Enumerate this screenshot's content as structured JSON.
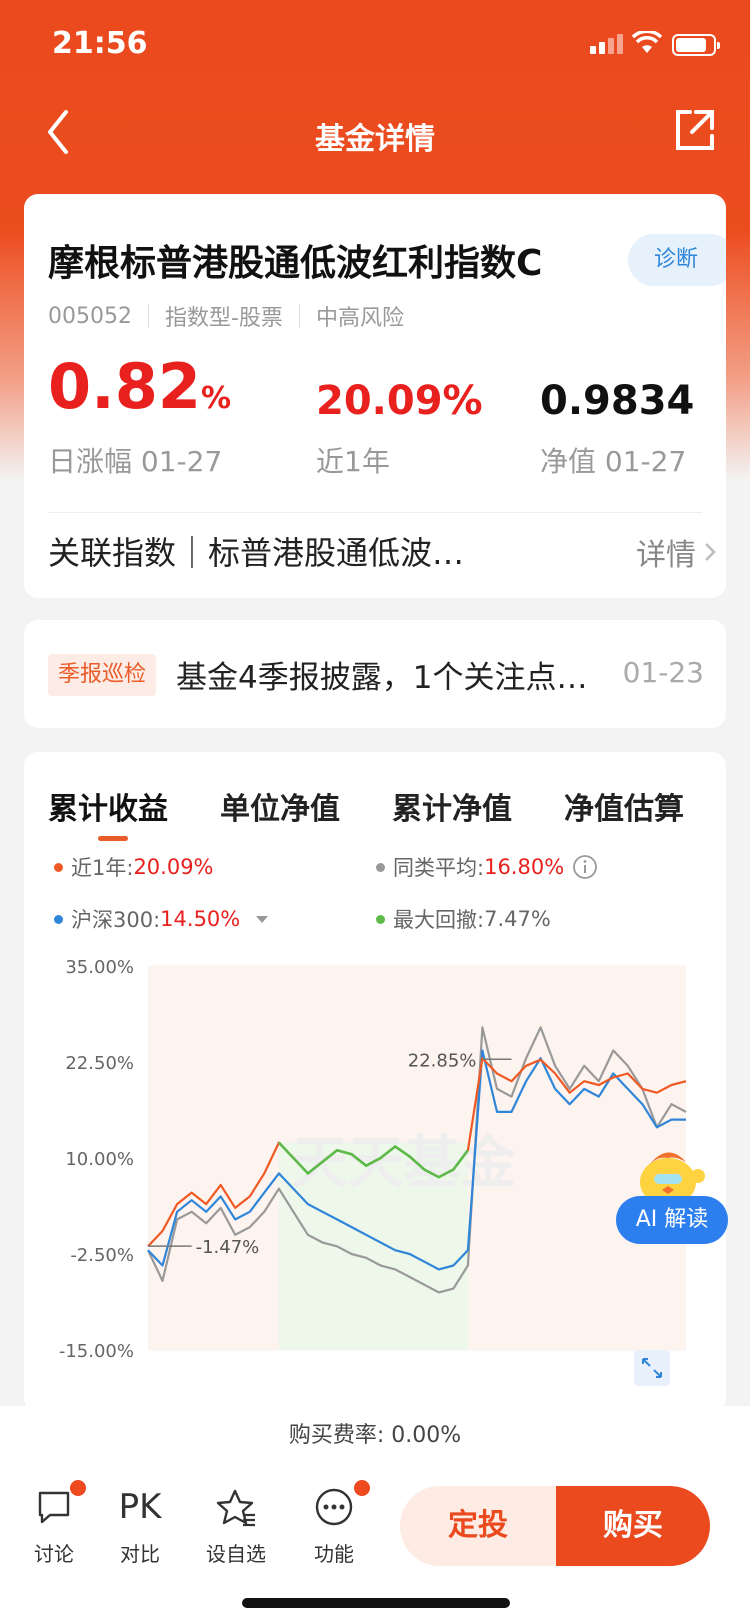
{
  "status": {
    "time": "21:56"
  },
  "nav": {
    "title": "基金详情"
  },
  "fund": {
    "name": "摩根标普港股通低波红利指数C",
    "diagnose": "诊断",
    "code": "005052",
    "type": "指数型-股票",
    "risk": "中高风险",
    "daily_change": "0.82",
    "daily_change_unit": "%",
    "daily_label": "日涨幅 01-27",
    "year_return": "20.09%",
    "year_label": "近1年",
    "nav_value": "0.9834",
    "nav_label": "净值 01-27",
    "index_text": "关联指数｜标普港股通低波…",
    "detail": "详情"
  },
  "quarter": {
    "tag": "季报巡检",
    "text": "基金4季报披露，1个关注点…",
    "date": "01-23"
  },
  "chart_section": {
    "tabs": [
      "累计收益",
      "单位净值",
      "累计净值",
      "净值估算"
    ],
    "legend": [
      {
        "label": "近1年:",
        "value": "20.09%",
        "color": "#ef5a24",
        "red": true
      },
      {
        "label": "同类平均:",
        "value": "16.80%",
        "color": "#999999",
        "red": true
      },
      {
        "label": "沪深300:",
        "value": "14.50%",
        "color": "#2f86d9",
        "red": true
      },
      {
        "label": "最大回撤:",
        "value": "7.47%",
        "color": "#5dba4a",
        "red": false
      }
    ],
    "annotations": {
      "high": "22.85%",
      "low": "-1.47%"
    },
    "watermark": "天天基金"
  },
  "chart_data": {
    "type": "line",
    "yticks": [
      "35.00%",
      "22.50%",
      "10.00%",
      "-2.50%",
      "-15.00%"
    ],
    "ylim": [
      -15,
      35
    ],
    "series": [
      {
        "name": "近1年",
        "color": "#ef5a24",
        "values": [
          -1.5,
          0.5,
          4,
          5.5,
          4,
          6.5,
          3.5,
          5,
          8,
          12,
          10,
          8,
          9.5,
          11,
          10.5,
          9,
          10,
          11.5,
          10.2,
          8.5,
          7.5,
          8.5,
          11,
          23,
          21,
          20,
          22,
          22.8,
          21,
          18.5,
          20,
          19.5,
          20.5,
          21,
          19,
          18.5,
          19.5,
          20
        ]
      },
      {
        "name": "同类平均",
        "color": "#999999",
        "values": [
          -2,
          -6,
          2,
          3,
          1.5,
          3.5,
          0,
          1,
          3,
          6,
          3,
          0,
          -1,
          -1.5,
          -2.5,
          -3,
          -4,
          -4.5,
          -5.5,
          -6.5,
          -7.5,
          -7,
          -4,
          27,
          19,
          18,
          23,
          27,
          22,
          19,
          22,
          20,
          24,
          22,
          19,
          14,
          17,
          16
        ]
      },
      {
        "name": "沪深300",
        "color": "#2f86d9",
        "values": [
          -2,
          -4,
          3,
          4.5,
          3,
          5,
          2,
          3,
          5.5,
          8,
          6,
          4,
          3,
          2,
          1,
          0,
          -1,
          -2,
          -2.5,
          -3.5,
          -4.5,
          -4,
          -2,
          24,
          16,
          16,
          20,
          23,
          19,
          17,
          19,
          18,
          21,
          19,
          17,
          14,
          15,
          15
        ]
      }
    ]
  },
  "ai": {
    "label": "AI 解读"
  },
  "fee": {
    "text": "购买费率: 0.00%"
  },
  "bottom": {
    "items": [
      {
        "label": "讨论"
      },
      {
        "label": "对比",
        "icon_text": "PK"
      },
      {
        "label": "设自选"
      },
      {
        "label": "功能"
      }
    ],
    "invest": "定投",
    "buy": "购买"
  }
}
